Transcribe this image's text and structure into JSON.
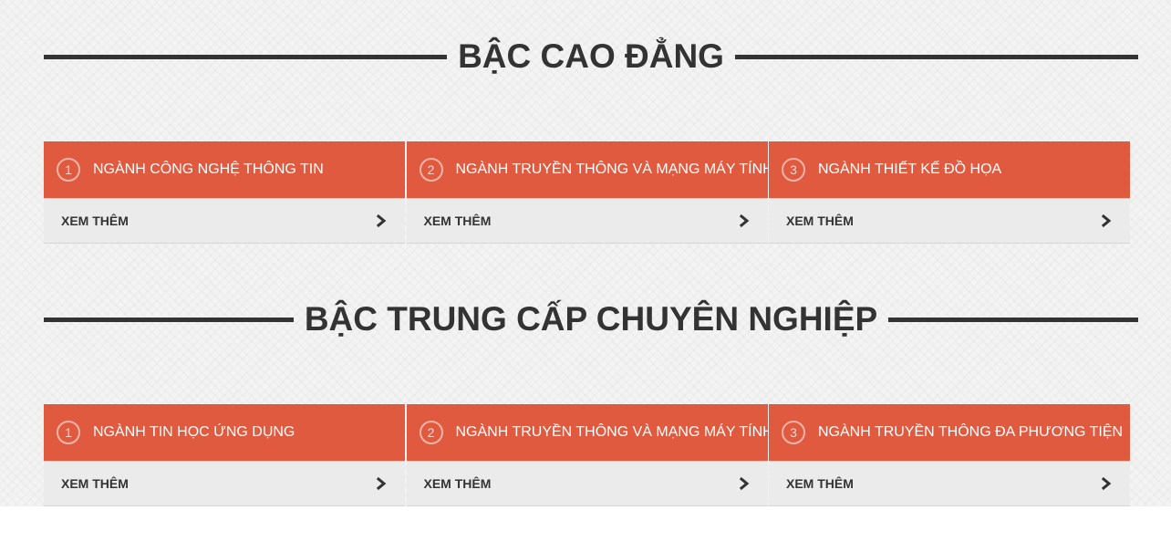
{
  "sections": [
    {
      "heading": "BẬC CAO ĐẲNG",
      "cards": [
        {
          "number": "1",
          "title": "NGÀNH CÔNG NGHỆ THÔNG TIN",
          "link_label": "XEM THÊM",
          "icon": "chevron-right-icon"
        },
        {
          "number": "2",
          "title": "NGÀNH TRUYỀN THÔNG VÀ MẠNG MÁY TÍNH",
          "link_label": "XEM THÊM",
          "icon": "chevron-right-icon"
        },
        {
          "number": "3",
          "title": "NGÀNH THIẾT KẾ ĐỒ HỌA",
          "link_label": "XEM THÊM",
          "icon": "chevron-right-icon"
        }
      ]
    },
    {
      "heading": "BẬC TRUNG CẤP CHUYÊN NGHIỆP",
      "cards": [
        {
          "number": "1",
          "title": "NGÀNH TIN HỌC ỨNG DỤNG",
          "link_label": "XEM THÊM",
          "icon": "chevron-right-icon"
        },
        {
          "number": "2",
          "title": "NGÀNH TRUYỀN THÔNG VÀ MẠNG MÁY TÍNH",
          "link_label": "XEM THÊM",
          "icon": "chevron-right-icon"
        },
        {
          "number": "3",
          "title": "NGÀNH TRUYỀN THÔNG ĐA PHƯƠNG TIỆN",
          "link_label": "XEM THÊM",
          "icon": "chevron-right-icon"
        }
      ]
    }
  ],
  "colors": {
    "accent": "#e05a3f",
    "heading": "#333333",
    "footer_bg": "#ebebeb",
    "page_bg": "#f3f3f3"
  }
}
